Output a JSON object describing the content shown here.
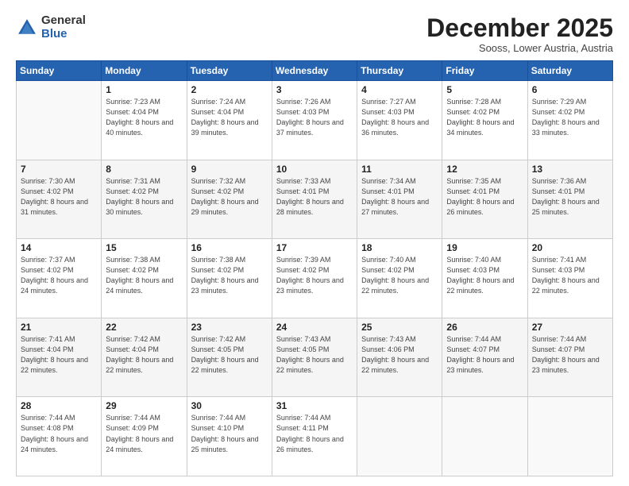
{
  "logo": {
    "general": "General",
    "blue": "Blue"
  },
  "header": {
    "month": "December 2025",
    "location": "Sooss, Lower Austria, Austria"
  },
  "days_of_week": [
    "Sunday",
    "Monday",
    "Tuesday",
    "Wednesday",
    "Thursday",
    "Friday",
    "Saturday"
  ],
  "weeks": [
    [
      {
        "day": "",
        "sunrise": "",
        "sunset": "",
        "daylight": ""
      },
      {
        "day": "1",
        "sunrise": "Sunrise: 7:23 AM",
        "sunset": "Sunset: 4:04 PM",
        "daylight": "Daylight: 8 hours and 40 minutes."
      },
      {
        "day": "2",
        "sunrise": "Sunrise: 7:24 AM",
        "sunset": "Sunset: 4:04 PM",
        "daylight": "Daylight: 8 hours and 39 minutes."
      },
      {
        "day": "3",
        "sunrise": "Sunrise: 7:26 AM",
        "sunset": "Sunset: 4:03 PM",
        "daylight": "Daylight: 8 hours and 37 minutes."
      },
      {
        "day": "4",
        "sunrise": "Sunrise: 7:27 AM",
        "sunset": "Sunset: 4:03 PM",
        "daylight": "Daylight: 8 hours and 36 minutes."
      },
      {
        "day": "5",
        "sunrise": "Sunrise: 7:28 AM",
        "sunset": "Sunset: 4:02 PM",
        "daylight": "Daylight: 8 hours and 34 minutes."
      },
      {
        "day": "6",
        "sunrise": "Sunrise: 7:29 AM",
        "sunset": "Sunset: 4:02 PM",
        "daylight": "Daylight: 8 hours and 33 minutes."
      }
    ],
    [
      {
        "day": "7",
        "sunrise": "Sunrise: 7:30 AM",
        "sunset": "Sunset: 4:02 PM",
        "daylight": "Daylight: 8 hours and 31 minutes."
      },
      {
        "day": "8",
        "sunrise": "Sunrise: 7:31 AM",
        "sunset": "Sunset: 4:02 PM",
        "daylight": "Daylight: 8 hours and 30 minutes."
      },
      {
        "day": "9",
        "sunrise": "Sunrise: 7:32 AM",
        "sunset": "Sunset: 4:02 PM",
        "daylight": "Daylight: 8 hours and 29 minutes."
      },
      {
        "day": "10",
        "sunrise": "Sunrise: 7:33 AM",
        "sunset": "Sunset: 4:01 PM",
        "daylight": "Daylight: 8 hours and 28 minutes."
      },
      {
        "day": "11",
        "sunrise": "Sunrise: 7:34 AM",
        "sunset": "Sunset: 4:01 PM",
        "daylight": "Daylight: 8 hours and 27 minutes."
      },
      {
        "day": "12",
        "sunrise": "Sunrise: 7:35 AM",
        "sunset": "Sunset: 4:01 PM",
        "daylight": "Daylight: 8 hours and 26 minutes."
      },
      {
        "day": "13",
        "sunrise": "Sunrise: 7:36 AM",
        "sunset": "Sunset: 4:01 PM",
        "daylight": "Daylight: 8 hours and 25 minutes."
      }
    ],
    [
      {
        "day": "14",
        "sunrise": "Sunrise: 7:37 AM",
        "sunset": "Sunset: 4:02 PM",
        "daylight": "Daylight: 8 hours and 24 minutes."
      },
      {
        "day": "15",
        "sunrise": "Sunrise: 7:38 AM",
        "sunset": "Sunset: 4:02 PM",
        "daylight": "Daylight: 8 hours and 24 minutes."
      },
      {
        "day": "16",
        "sunrise": "Sunrise: 7:38 AM",
        "sunset": "Sunset: 4:02 PM",
        "daylight": "Daylight: 8 hours and 23 minutes."
      },
      {
        "day": "17",
        "sunrise": "Sunrise: 7:39 AM",
        "sunset": "Sunset: 4:02 PM",
        "daylight": "Daylight: 8 hours and 23 minutes."
      },
      {
        "day": "18",
        "sunrise": "Sunrise: 7:40 AM",
        "sunset": "Sunset: 4:02 PM",
        "daylight": "Daylight: 8 hours and 22 minutes."
      },
      {
        "day": "19",
        "sunrise": "Sunrise: 7:40 AM",
        "sunset": "Sunset: 4:03 PM",
        "daylight": "Daylight: 8 hours and 22 minutes."
      },
      {
        "day": "20",
        "sunrise": "Sunrise: 7:41 AM",
        "sunset": "Sunset: 4:03 PM",
        "daylight": "Daylight: 8 hours and 22 minutes."
      }
    ],
    [
      {
        "day": "21",
        "sunrise": "Sunrise: 7:41 AM",
        "sunset": "Sunset: 4:04 PM",
        "daylight": "Daylight: 8 hours and 22 minutes."
      },
      {
        "day": "22",
        "sunrise": "Sunrise: 7:42 AM",
        "sunset": "Sunset: 4:04 PM",
        "daylight": "Daylight: 8 hours and 22 minutes."
      },
      {
        "day": "23",
        "sunrise": "Sunrise: 7:42 AM",
        "sunset": "Sunset: 4:05 PM",
        "daylight": "Daylight: 8 hours and 22 minutes."
      },
      {
        "day": "24",
        "sunrise": "Sunrise: 7:43 AM",
        "sunset": "Sunset: 4:05 PM",
        "daylight": "Daylight: 8 hours and 22 minutes."
      },
      {
        "day": "25",
        "sunrise": "Sunrise: 7:43 AM",
        "sunset": "Sunset: 4:06 PM",
        "daylight": "Daylight: 8 hours and 22 minutes."
      },
      {
        "day": "26",
        "sunrise": "Sunrise: 7:44 AM",
        "sunset": "Sunset: 4:07 PM",
        "daylight": "Daylight: 8 hours and 23 minutes."
      },
      {
        "day": "27",
        "sunrise": "Sunrise: 7:44 AM",
        "sunset": "Sunset: 4:07 PM",
        "daylight": "Daylight: 8 hours and 23 minutes."
      }
    ],
    [
      {
        "day": "28",
        "sunrise": "Sunrise: 7:44 AM",
        "sunset": "Sunset: 4:08 PM",
        "daylight": "Daylight: 8 hours and 24 minutes."
      },
      {
        "day": "29",
        "sunrise": "Sunrise: 7:44 AM",
        "sunset": "Sunset: 4:09 PM",
        "daylight": "Daylight: 8 hours and 24 minutes."
      },
      {
        "day": "30",
        "sunrise": "Sunrise: 7:44 AM",
        "sunset": "Sunset: 4:10 PM",
        "daylight": "Daylight: 8 hours and 25 minutes."
      },
      {
        "day": "31",
        "sunrise": "Sunrise: 7:44 AM",
        "sunset": "Sunset: 4:11 PM",
        "daylight": "Daylight: 8 hours and 26 minutes."
      },
      {
        "day": "",
        "sunrise": "",
        "sunset": "",
        "daylight": ""
      },
      {
        "day": "",
        "sunrise": "",
        "sunset": "",
        "daylight": ""
      },
      {
        "day": "",
        "sunrise": "",
        "sunset": "",
        "daylight": ""
      }
    ]
  ]
}
